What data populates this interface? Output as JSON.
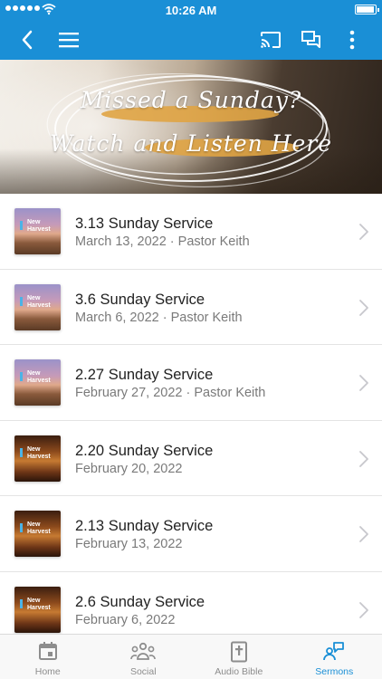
{
  "status": {
    "time": "10:26 AM",
    "battery_level": 0.95
  },
  "header": {
    "back_icon": "back-chevron-icon",
    "menu_icon": "hamburger-menu-icon",
    "cast_icon": "cast-icon",
    "chat_icon": "chat-icon",
    "more_icon": "more-vertical-icon"
  },
  "hero": {
    "line1": "Missed a Sunday?",
    "line2": "Watch and Listen Here"
  },
  "sermons": [
    {
      "title": "3.13 Sunday Service",
      "subtitle": "March 13, 2022 · Pastor Keith",
      "thumb_text": "New Harvest",
      "thumb_style": "desert"
    },
    {
      "title": "3.6 Sunday Service",
      "subtitle": "March 6, 2022 · Pastor Keith",
      "thumb_text": "New Harvest",
      "thumb_style": "desert"
    },
    {
      "title": "2.27 Sunday Service",
      "subtitle": "February 27, 2022 · Pastor Keith",
      "thumb_text": "New Harvest",
      "thumb_style": "desert"
    },
    {
      "title": "2.20 Sunday Service",
      "subtitle": "February 20, 2022",
      "thumb_text": "New Harvest",
      "thumb_style": "lights"
    },
    {
      "title": "2.13 Sunday Service",
      "subtitle": "February 13, 2022",
      "thumb_text": "New Harvest",
      "thumb_style": "lights"
    },
    {
      "title": "2.6 Sunday Service",
      "subtitle": "February 6, 2022",
      "thumb_text": "New Harvest",
      "thumb_style": "lights"
    }
  ],
  "tabs": [
    {
      "label": "Home",
      "icon": "calendar-icon",
      "active": false
    },
    {
      "label": "Social",
      "icon": "people-icon",
      "active": false
    },
    {
      "label": "Audio Bible",
      "icon": "bible-icon",
      "active": false
    },
    {
      "label": "Sermons",
      "icon": "sermons-icon",
      "active": true
    }
  ],
  "colors": {
    "brand_blue": "#1a8fd6",
    "tab_inactive": "#8d8d8d",
    "chevron": "#c7c7cc"
  }
}
